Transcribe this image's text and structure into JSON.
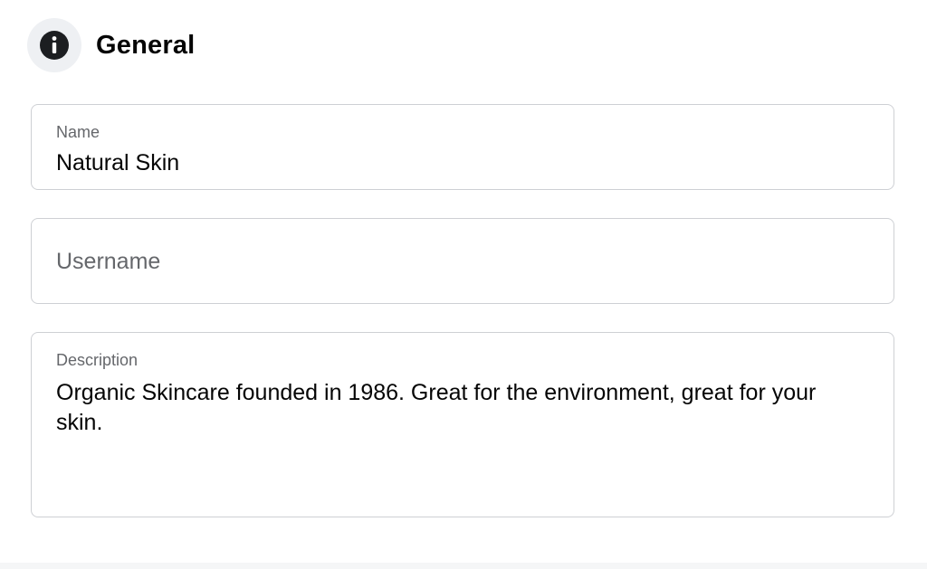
{
  "section": {
    "title": "General",
    "icon": "info-icon"
  },
  "fields": {
    "name": {
      "label": "Name",
      "value": "Natural Skin"
    },
    "username": {
      "placeholder": "Username",
      "value": ""
    },
    "description": {
      "label": "Description",
      "value": "Organic Skincare founded in 1986. Great for the environment, great for your skin."
    }
  },
  "colors": {
    "icon_bg": "#eef0f3",
    "icon_fg": "#1c1e21",
    "border": "#ced0d4",
    "label": "#65676b",
    "text": "#050505"
  }
}
